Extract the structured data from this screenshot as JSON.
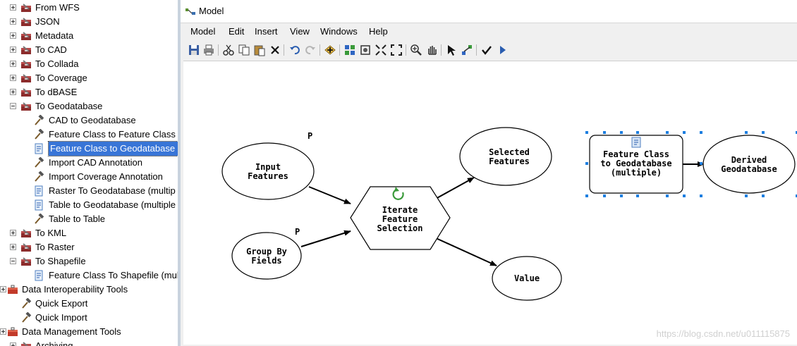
{
  "tree": {
    "items": [
      {
        "label": "From WFS",
        "expander": "plus",
        "icon": "toolbox-icon"
      },
      {
        "label": "JSON",
        "expander": "plus",
        "icon": "toolbox-icon"
      },
      {
        "label": "Metadata",
        "expander": "plus",
        "icon": "toolbox-icon"
      },
      {
        "label": "To CAD",
        "expander": "plus",
        "icon": "toolbox-icon"
      },
      {
        "label": "To Collada",
        "expander": "plus",
        "icon": "toolbox-icon"
      },
      {
        "label": "To Coverage",
        "expander": "plus",
        "icon": "toolbox-icon"
      },
      {
        "label": "To dBASE",
        "expander": "plus",
        "icon": "toolbox-icon"
      },
      {
        "label": "To Geodatabase",
        "expander": "minus",
        "icon": "toolbox-icon"
      },
      {
        "label": "CAD to Geodatabase",
        "icon": "hammer-icon"
      },
      {
        "label": "Feature Class to Feature Class",
        "icon": "hammer-icon"
      },
      {
        "label": "Feature Class to Geodatabase (",
        "icon": "script-icon",
        "selected": true
      },
      {
        "label": "Import CAD Annotation",
        "icon": "hammer-icon"
      },
      {
        "label": "Import Coverage Annotation",
        "icon": "hammer-icon"
      },
      {
        "label": "Raster To Geodatabase (multip",
        "icon": "script-icon"
      },
      {
        "label": "Table to Geodatabase (multiple",
        "icon": "script-icon"
      },
      {
        "label": "Table to Table",
        "icon": "hammer-icon"
      },
      {
        "label": "To KML",
        "expander": "plus",
        "icon": "toolbox-icon"
      },
      {
        "label": "To Raster",
        "expander": "plus",
        "icon": "toolbox-icon"
      },
      {
        "label": "To Shapefile",
        "expander": "minus",
        "icon": "toolbox-icon"
      },
      {
        "label": "Feature Class To Shapefile (mul",
        "icon": "script-icon"
      },
      {
        "label": "Data Interoperability Tools",
        "expander": "plus",
        "icon": "red-toolbox-icon"
      },
      {
        "label": "Quick Export",
        "icon": "hammer-icon"
      },
      {
        "label": "Quick Import",
        "icon": "hammer-icon"
      },
      {
        "label": "Data Management Tools",
        "expander": "plus",
        "icon": "red-toolbox-icon"
      },
      {
        "label": "Archiving",
        "expander": "plus",
        "icon": "toolbox-icon"
      }
    ]
  },
  "window": {
    "title": "Model",
    "menu": [
      "Model",
      "Edit",
      "Insert",
      "View",
      "Windows",
      "Help"
    ],
    "toolbar": [
      "save-icon",
      "print-icon",
      "cut-icon",
      "copy-icon",
      "paste-icon",
      "delete-icon",
      "undo-icon",
      "redo-icon",
      "add-data-icon",
      "auto-layout-icon",
      "full-extent-icon",
      "fit-icon",
      "fixed-zoom-icon",
      "zoom-in-icon",
      "pan-icon",
      "select-icon",
      "connect-icon",
      "validate-icon",
      "run-icon"
    ]
  },
  "diagram": {
    "nodes": {
      "input_features": {
        "lines": [
          "Input",
          "Features"
        ],
        "param": "P"
      },
      "group_by_fields": {
        "lines": [
          "Group By",
          "Fields"
        ],
        "param": "P"
      },
      "iterate": {
        "lines": [
          "Iterate",
          "Feature",
          "Selection"
        ]
      },
      "selected_features": {
        "lines": [
          "Selected",
          "Features"
        ]
      },
      "value": {
        "lines": [
          "Value"
        ]
      },
      "fc_to_gdb": {
        "lines": [
          "Feature Class",
          "to Geodatabase",
          "(multiple)"
        ]
      },
      "derived_gdb": {
        "lines": [
          "Derived",
          "Geodatabase"
        ]
      }
    }
  },
  "watermark": "https://blog.csdn.net/u011115875"
}
